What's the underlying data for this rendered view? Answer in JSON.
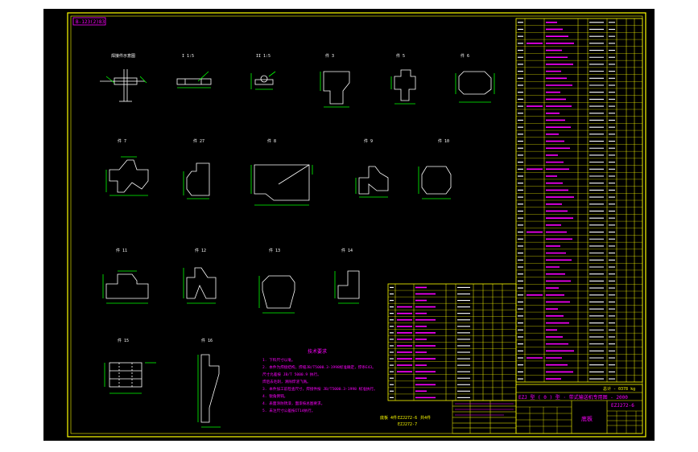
{
  "viewer": {
    "background_color": "#000000",
    "page_color": "#ffffff"
  },
  "drawing": {
    "drawing_number_tag": "B-123(2)83",
    "title_block": {
      "product_title": "EZJ 型 ( 0 ) 型 · 带式输送机专用图 - 2000",
      "drawing_number": "EZJ272-6",
      "part_name": "底板",
      "mass_label": "总计 - 0378 kg"
    },
    "notes_title": "技术要求",
    "notes": [
      "1. 下料尺寸以毫。",
      "2. 本件为焊接结构，焊缝JB/T5000.3-1998标准确定，焊条E43。",
      "   尺寸允差按 JB/T 5000.9 执行。",
      "   焊后去毛刺，清除焊渣飞溅。",
      "3. 本件加工前检查尺寸，焊接件按 JB/T5000.3-1998 标准执行。",
      "4. 锐角倒钝。",
      "4. 表面涂防锈漆，面漆按总图要求。",
      "5. 未注尺寸公差按IT14执行。"
    ],
    "ref_texts": [
      "底板 4件",
      "EZJ272-6",
      "EZJ272-7",
      "共4件"
    ],
    "views": [
      {
        "label": "焊接件示意图",
        "id": "v1"
      },
      {
        "label": "I  1:5",
        "id": "v2"
      },
      {
        "label": "II  1:5",
        "id": "v3"
      },
      {
        "label": "件 3",
        "id": "v4"
      },
      {
        "label": "件 5",
        "id": "v5"
      },
      {
        "label": "件 6",
        "id": "v6"
      },
      {
        "label": "件 7",
        "id": "v7"
      },
      {
        "label": "件 27",
        "id": "v8"
      },
      {
        "label": "件 8",
        "id": "v9"
      },
      {
        "label": "件 9",
        "id": "v10"
      },
      {
        "label": "件 10",
        "id": "v11"
      },
      {
        "label": "件 11",
        "id": "v12"
      },
      {
        "label": "件 12",
        "id": "v13"
      },
      {
        "label": "件 13",
        "id": "v14"
      },
      {
        "label": "件 14",
        "id": "v15"
      },
      {
        "label": "件 15",
        "id": "v16"
      },
      {
        "label": "件 16",
        "id": "v17"
      }
    ],
    "bom_right": {
      "row_count": 52
    },
    "bom_left": {
      "row_count": 18
    }
  }
}
